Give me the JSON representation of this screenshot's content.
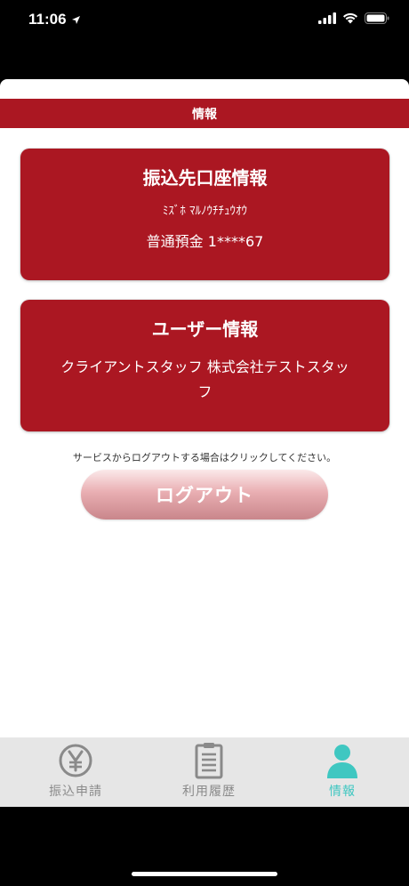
{
  "status_bar": {
    "time": "11:06"
  },
  "header": {
    "title": "情報"
  },
  "bank_card": {
    "title": "振込先口座情報",
    "bank_name": "ﾐｽﾞﾎ ﾏﾙﾉｳﾁﾁｭｳｵｳ",
    "account": "普通預金 1****67"
  },
  "user_card": {
    "title": "ユーザー情報",
    "name": "クライアントスタッフ 株式会社テストスタッフ"
  },
  "logout": {
    "note": "サービスからログアウトする場合はクリックしてください。",
    "button_label": "ログアウト"
  },
  "tabs": [
    {
      "label": "振込申請",
      "icon": "yen-icon",
      "active": false
    },
    {
      "label": "利用履歴",
      "icon": "clipboard-icon",
      "active": false
    },
    {
      "label": "情報",
      "icon": "person-icon",
      "active": true
    }
  ],
  "colors": {
    "brand_red": "#ab1722",
    "tab_active": "#3fc7c1",
    "tab_inactive": "#8a8a8a"
  }
}
